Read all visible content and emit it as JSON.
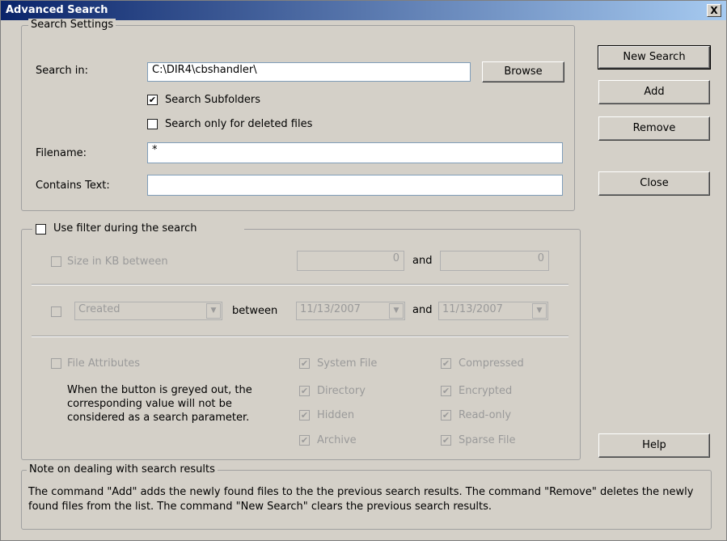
{
  "window": {
    "title": "Advanced Search",
    "close_label": "X"
  },
  "search_settings": {
    "legend": "Search Settings",
    "search_in_label": "Search in:",
    "search_in_value": "C:\\DIR4\\cbshandler\\",
    "browse_label": "Browse",
    "subfolders_label": "Search Subfolders",
    "subfolders_checked": true,
    "deleted_label": "Search only for deleted files",
    "deleted_checked": false,
    "filename_label": "Filename:",
    "filename_value": "*",
    "contains_label": "Contains Text:",
    "contains_value": ""
  },
  "filter": {
    "use_filter_label": "Use filter during the search",
    "size_label": "Size in KB between",
    "size_min": "0",
    "and_label": "and",
    "size_max": "0",
    "date_type": "Created",
    "between_label": "between",
    "date_from": "11/13/2007",
    "date_to": "11/13/2007",
    "attributes_label": "File Attributes",
    "attributes_note": "When the button is greyed out, the corresponding value will not be considered as a search parameter.",
    "attributes": {
      "system": "System File",
      "directory": "Directory",
      "hidden": "Hidden",
      "archive": "Archive",
      "compressed": "Compressed",
      "encrypted": "Encrypted",
      "readonly": "Read-only",
      "sparse": "Sparse File"
    }
  },
  "buttons": {
    "new_search": "New Search",
    "add": "Add",
    "remove": "Remove",
    "close": "Close",
    "help": "Help"
  },
  "note": {
    "legend": "Note on dealing with search results",
    "text": "The command \"Add\" adds the newly found files to the the previous search results. The command \"Remove\" deletes the newly found files from the list. The command \"New Search\" clears the previous search results."
  }
}
